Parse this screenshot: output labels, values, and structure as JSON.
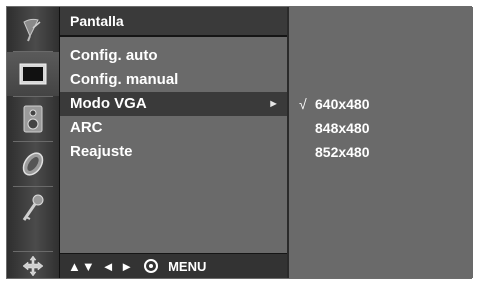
{
  "icon_bar": {
    "items": [
      {
        "icon": "antenna-icon",
        "active": false
      },
      {
        "icon": "screen-icon",
        "active": true
      },
      {
        "icon": "speaker-icon",
        "active": false
      },
      {
        "icon": "clock-icon",
        "active": false
      },
      {
        "icon": "key-icon",
        "active": false
      },
      {
        "icon": "move-icon",
        "active": false
      }
    ]
  },
  "menu": {
    "title": "Pantalla",
    "items": [
      {
        "label": "Config. auto"
      },
      {
        "label": "Config. manual"
      },
      {
        "label": "Modo VGA",
        "selected": true,
        "arrow": "►"
      },
      {
        "label": "ARC"
      },
      {
        "label": "Reajuste"
      }
    ],
    "footer": {
      "nav_up_down": "▲▼",
      "nav_left_right": "◄ ►",
      "menu_label": "MENU"
    }
  },
  "submenu": {
    "check_mark": "√",
    "items": [
      {
        "label": "640x480",
        "checked": true
      },
      {
        "label": "848x480",
        "checked": false
      },
      {
        "label": "852x480",
        "checked": false
      }
    ]
  },
  "colors": {
    "panel": "#6a6a6a",
    "header": "#3a3a3a",
    "selected_row": "#3a3a3a",
    "text": "#ffffff"
  }
}
